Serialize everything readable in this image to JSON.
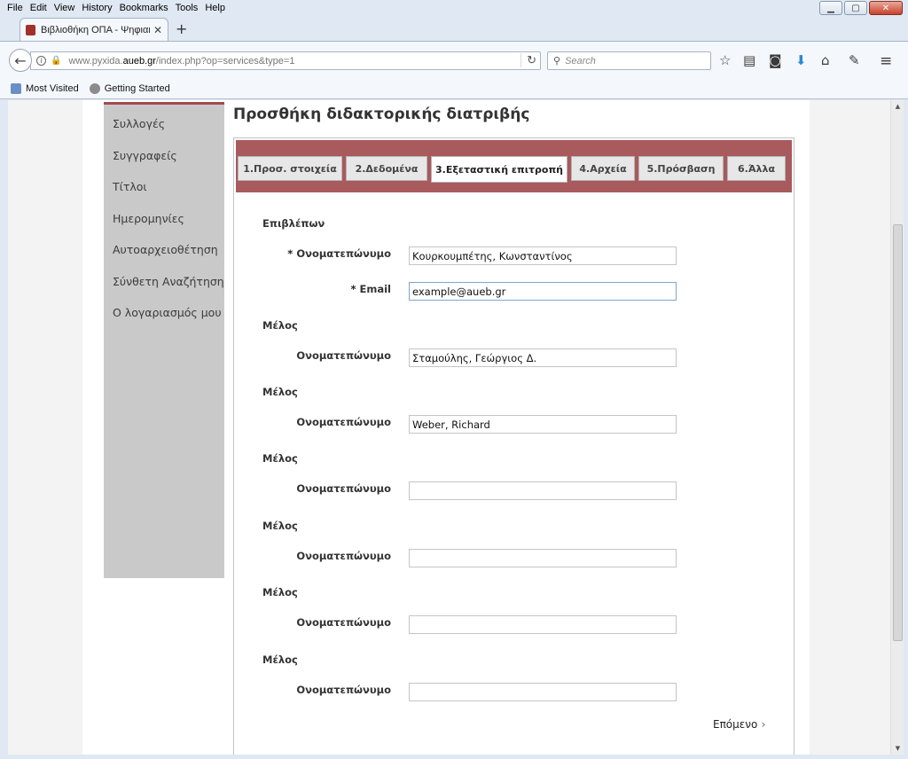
{
  "menubar": {
    "items": [
      "File",
      "Edit",
      "View",
      "History",
      "Bookmarks",
      "Tools",
      "Help"
    ]
  },
  "tab": {
    "title": "Βιβλιοθήκη ΟΠΑ - Ψηφιακ..."
  },
  "navbar": {
    "url_prefix": "www.pyxida.",
    "url_domain": "aueb.gr",
    "url_suffix": "/index.php?op=services&type=1",
    "search_placeholder": "Search"
  },
  "bookmarks": [
    "Most Visited",
    "Getting Started"
  ],
  "sidebar": {
    "items": [
      "Συλλογές",
      "Συγγραφείς",
      "Τίτλοι",
      "Ημερομηνίες",
      "Αυτοαρχειοθέτηση",
      "Σύνθετη Αναζήτηση",
      "Ο λογαριασμός μου"
    ]
  },
  "page": {
    "title": "Προσθήκη διδακτορικής διατριβής"
  },
  "form_tabs": [
    "1.Προσ. στοιχεία",
    "2.Δεδομένα",
    "3.Εξεταστική επιτροπή",
    "4.Αρχεία",
    "5.Πρόσβαση",
    "6.Άλλα"
  ],
  "active_tab_index": 2,
  "form": {
    "supervisor": {
      "section": "Επιβλέπων",
      "name_label": "Ονοματεπώνυμο",
      "name_value": "Κουρκουμπέτης, Κωνσταντίνος",
      "email_label": "Email",
      "email_value": "example@aueb.gr",
      "required_mark": "*"
    },
    "members": [
      {
        "section": "Μέλος",
        "label": "Ονοματεπώνυμο",
        "value": "Σταμούλης, Γεώργιος Δ."
      },
      {
        "section": "Μέλος",
        "label": "Ονοματεπώνυμο",
        "value": "Weber, Richard"
      },
      {
        "section": "Μέλος",
        "label": "Ονοματεπώνυμο",
        "value": ""
      },
      {
        "section": "Μέλος",
        "label": "Ονοματεπώνυμο",
        "value": ""
      },
      {
        "section": "Μέλος",
        "label": "Ονοματεπώνυμο",
        "value": ""
      },
      {
        "section": "Μέλος",
        "label": "Ονοματεπώνυμο",
        "value": ""
      }
    ],
    "next_label": "Επόμενο"
  }
}
